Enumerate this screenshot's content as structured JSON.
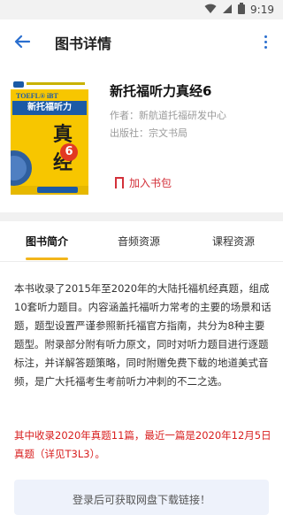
{
  "status_bar": {
    "time": "9:19"
  },
  "app_bar": {
    "title": "图书详情"
  },
  "book": {
    "title": "新托福听力真经6",
    "author_label": "作者：",
    "author": "新航道托福研发中心",
    "publisher_label": "出版社：",
    "publisher": "宗文书局",
    "add_button": "加入书包",
    "cover": {
      "brand_line": "TOEFL® iBT",
      "series_name": "新托福听力",
      "handwritten": "真经",
      "volume": "6"
    }
  },
  "tabs": [
    {
      "label": "图书简介",
      "active": true
    },
    {
      "label": "音频资源",
      "active": false
    },
    {
      "label": "课程资源",
      "active": false
    }
  ],
  "description": "本书收录了2015年至2020年的大陆托福机经真题，组成10套听力题目。内容涵盖托福听力常考的主要的场景和话题，题型设置严谨参照新托福官方指南，共分为8种主要题型。附录部分附有听力原文，同时对听力题目进行逐题标注，并详解答题策略，同时附赠免费下载的地道美式音频，是广大托福考生考前听力冲刺的不二之选。",
  "note": "其中收录2020年真题11篇，最近一篇是2020年12月5日真题（详见T3L3）。",
  "login_prompt": "登录后可获取网盘下载链接！",
  "colors": {
    "accent": "#2b6fcf",
    "red": "#d3313a",
    "tab_underline": "#f2b51b"
  }
}
